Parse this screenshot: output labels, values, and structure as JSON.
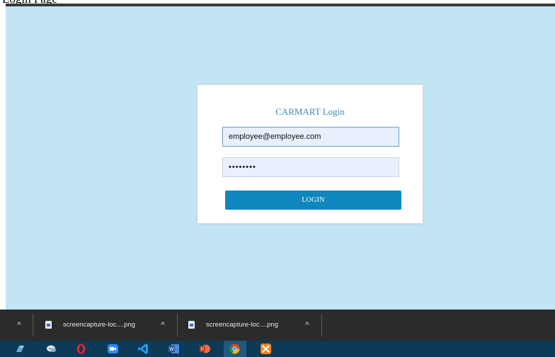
{
  "caption": {
    "text": "Login Page"
  },
  "login": {
    "title": "CARMART Login",
    "email_value": "employee@employee.com",
    "password_value": "••••••••",
    "button_label": "LOGIN"
  },
  "downloads": {
    "items": [
      {
        "name": "screencapture-loc....png"
      },
      {
        "name": "screencapture-loc....png"
      }
    ]
  },
  "taskbar": {
    "icons": [
      "sync-app-icon",
      "chat-bubbles-icon",
      "opera-icon",
      "zoom-icon",
      "vscode-icon",
      "word-icon",
      "powerpoint-icon",
      "chrome-icon",
      "xampp-icon"
    ]
  },
  "colors": {
    "page_background": "#c2e5f4",
    "title_color": "#3d8ab3",
    "button_color": "#0f86bd",
    "download_bar": "#2b2b2b",
    "taskbar": "#0c3a57"
  }
}
